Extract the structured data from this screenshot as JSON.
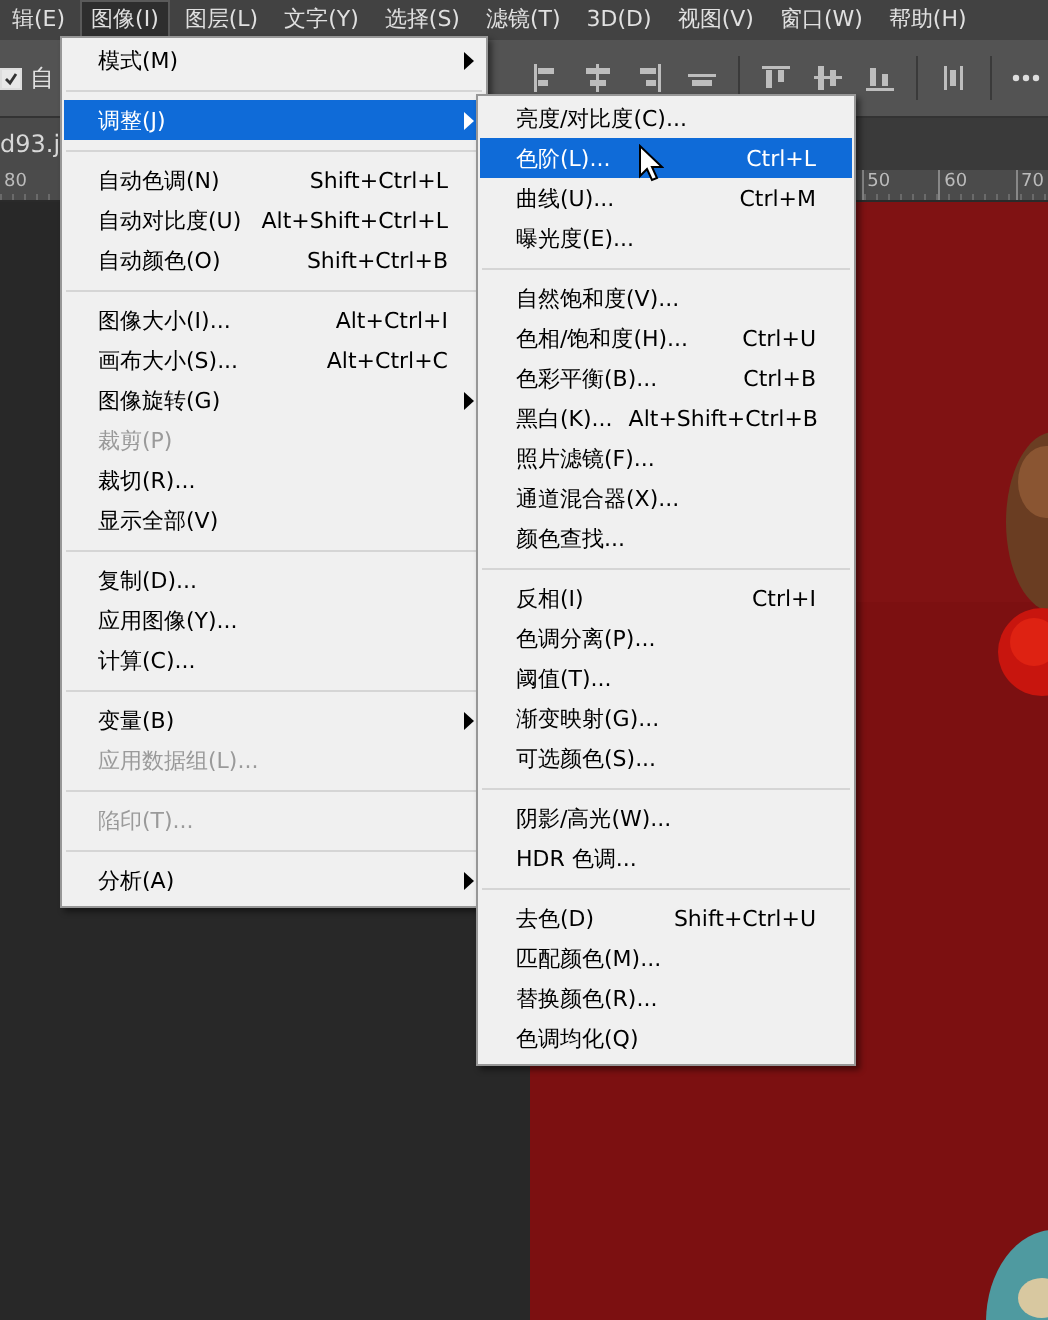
{
  "menubar": {
    "items": [
      {
        "label": "辑(E)",
        "selected": false
      },
      {
        "label": "图像(I)",
        "selected": true
      },
      {
        "label": "图层(L)",
        "selected": false
      },
      {
        "label": "文字(Y)",
        "selected": false
      },
      {
        "label": "选择(S)",
        "selected": false
      },
      {
        "label": "滤镜(T)",
        "selected": false
      },
      {
        "label": "3D(D)",
        "selected": false
      },
      {
        "label": "视图(V)",
        "selected": false
      },
      {
        "label": "窗口(W)",
        "selected": false
      },
      {
        "label": "帮助(H)",
        "selected": false
      }
    ]
  },
  "options_bar": {
    "auto_select": {
      "label": "自",
      "checked": true
    }
  },
  "document_tab": {
    "title": "d93.j"
  },
  "ruler": {
    "left_label": "80",
    "right_labels": [
      "50",
      "60",
      "70"
    ]
  },
  "image_menu": {
    "groups": [
      {
        "items": [
          {
            "label": "模式(M)",
            "submenu": true,
            "disabled": false,
            "selected": false
          }
        ]
      },
      {
        "items": [
          {
            "label": "调整(J)",
            "submenu": true,
            "disabled": false,
            "selected": true
          }
        ]
      },
      {
        "items": [
          {
            "label": "自动色调(N)",
            "shortcut": "Shift+Ctrl+L",
            "submenu": false,
            "disabled": false,
            "selected": false
          },
          {
            "label": "自动对比度(U)",
            "shortcut": "Alt+Shift+Ctrl+L",
            "submenu": false,
            "disabled": false,
            "selected": false
          },
          {
            "label": "自动颜色(O)",
            "shortcut": "Shift+Ctrl+B",
            "submenu": false,
            "disabled": false,
            "selected": false
          }
        ]
      },
      {
        "items": [
          {
            "label": "图像大小(I)...",
            "shortcut": "Alt+Ctrl+I",
            "submenu": false,
            "disabled": false,
            "selected": false
          },
          {
            "label": "画布大小(S)...",
            "shortcut": "Alt+Ctrl+C",
            "submenu": false,
            "disabled": false,
            "selected": false
          },
          {
            "label": "图像旋转(G)",
            "submenu": true,
            "disabled": false,
            "selected": false
          },
          {
            "label": "裁剪(P)",
            "submenu": false,
            "disabled": true,
            "selected": false
          },
          {
            "label": "裁切(R)...",
            "submenu": false,
            "disabled": false,
            "selected": false
          },
          {
            "label": "显示全部(V)",
            "submenu": false,
            "disabled": false,
            "selected": false
          }
        ]
      },
      {
        "items": [
          {
            "label": "复制(D)...",
            "submenu": false,
            "disabled": false,
            "selected": false
          },
          {
            "label": "应用图像(Y)...",
            "submenu": false,
            "disabled": false,
            "selected": false
          },
          {
            "label": "计算(C)...",
            "submenu": false,
            "disabled": false,
            "selected": false
          }
        ]
      },
      {
        "items": [
          {
            "label": "变量(B)",
            "submenu": true,
            "disabled": false,
            "selected": false
          },
          {
            "label": "应用数据组(L)...",
            "submenu": false,
            "disabled": true,
            "selected": false
          }
        ]
      },
      {
        "items": [
          {
            "label": "陷印(T)...",
            "submenu": false,
            "disabled": true,
            "selected": false
          }
        ]
      },
      {
        "items": [
          {
            "label": "分析(A)",
            "submenu": true,
            "disabled": false,
            "selected": false
          }
        ]
      }
    ]
  },
  "adjust_submenu": {
    "groups": [
      {
        "items": [
          {
            "label": "亮度/对比度(C)...",
            "submenu": false,
            "disabled": false,
            "selected": false
          },
          {
            "label": "色阶(L)...",
            "shortcut": "Ctrl+L",
            "submenu": false,
            "disabled": false,
            "selected": true
          },
          {
            "label": "曲线(U)...",
            "shortcut": "Ctrl+M",
            "submenu": false,
            "disabled": false,
            "selected": false
          },
          {
            "label": "曝光度(E)...",
            "submenu": false,
            "disabled": false,
            "selected": false
          }
        ]
      },
      {
        "items": [
          {
            "label": "自然饱和度(V)...",
            "submenu": false,
            "disabled": false,
            "selected": false
          },
          {
            "label": "色相/饱和度(H)...",
            "shortcut": "Ctrl+U",
            "submenu": false,
            "disabled": false,
            "selected": false
          },
          {
            "label": "色彩平衡(B)...",
            "shortcut": "Ctrl+B",
            "submenu": false,
            "disabled": false,
            "selected": false
          },
          {
            "label": "黑白(K)...",
            "shortcut": "Alt+Shift+Ctrl+B",
            "submenu": false,
            "disabled": false,
            "selected": false
          },
          {
            "label": "照片滤镜(F)...",
            "submenu": false,
            "disabled": false,
            "selected": false
          },
          {
            "label": "通道混合器(X)...",
            "submenu": false,
            "disabled": false,
            "selected": false
          },
          {
            "label": "颜色查找...",
            "submenu": false,
            "disabled": false,
            "selected": false
          }
        ]
      },
      {
        "items": [
          {
            "label": "反相(I)",
            "shortcut": "Ctrl+I",
            "submenu": false,
            "disabled": false,
            "selected": false
          },
          {
            "label": "色调分离(P)...",
            "submenu": false,
            "disabled": false,
            "selected": false
          },
          {
            "label": "阈值(T)...",
            "submenu": false,
            "disabled": false,
            "selected": false
          },
          {
            "label": "渐变映射(G)...",
            "submenu": false,
            "disabled": false,
            "selected": false
          },
          {
            "label": "可选颜色(S)...",
            "submenu": false,
            "disabled": false,
            "selected": false
          }
        ]
      },
      {
        "items": [
          {
            "label": "阴影/高光(W)...",
            "submenu": false,
            "disabled": false,
            "selected": false
          },
          {
            "label": "HDR 色调...",
            "submenu": false,
            "disabled": false,
            "selected": false
          }
        ]
      },
      {
        "items": [
          {
            "label": "去色(D)",
            "shortcut": "Shift+Ctrl+U",
            "submenu": false,
            "disabled": false,
            "selected": false
          },
          {
            "label": "匹配颜色(M)...",
            "submenu": false,
            "disabled": false,
            "selected": false
          },
          {
            "label": "替换颜色(R)...",
            "submenu": false,
            "disabled": false,
            "selected": false
          },
          {
            "label": "色调均化(Q)",
            "submenu": false,
            "disabled": false,
            "selected": false
          }
        ]
      }
    ]
  }
}
